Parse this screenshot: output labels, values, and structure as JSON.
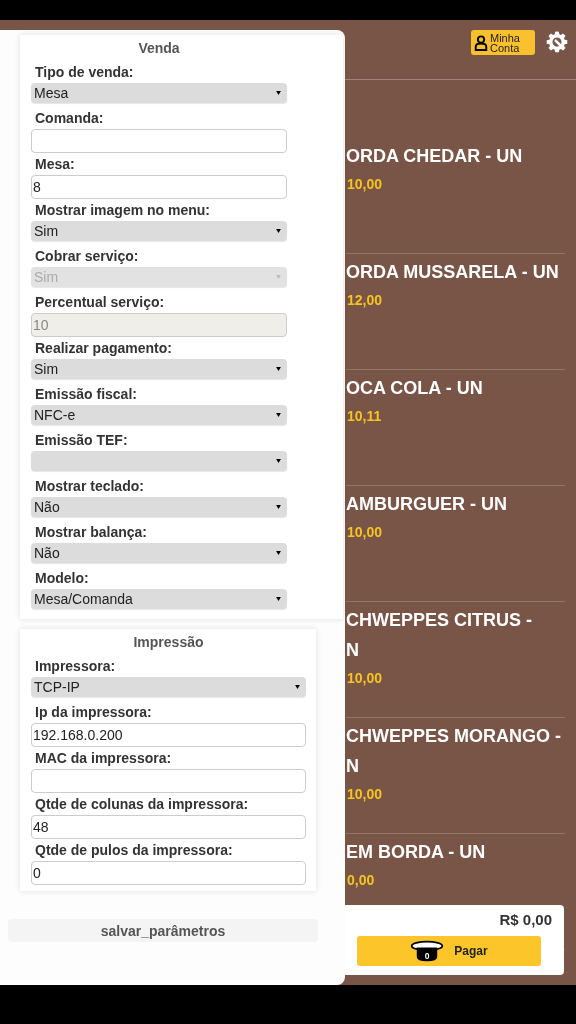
{
  "header": {
    "account_button": {
      "label": "Minha Conta"
    }
  },
  "products": [
    {
      "lines": [
        "ORDA CHEDAR - UN"
      ],
      "price": "10,00"
    },
    {
      "lines": [
        "ORDA MUSSARELA - UN"
      ],
      "price": "12,00"
    },
    {
      "lines": [
        "OCA COLA - UN"
      ],
      "price": "10,11"
    },
    {
      "lines": [
        "AMBURGUER - UN"
      ],
      "price": "10,00"
    },
    {
      "lines": [
        "CHWEPPES CITRUS -",
        "N"
      ],
      "price": "10,00"
    },
    {
      "lines": [
        "CHWEPPES MORANGO -",
        "N"
      ],
      "price": "10,00"
    },
    {
      "lines": [
        "EM BORDA - UN"
      ],
      "price": "0,00"
    }
  ],
  "cart": {
    "total": "R$ 0,00",
    "item_count": "0",
    "pay_button": "Pagar"
  },
  "settings": {
    "sections": [
      {
        "title": "Venda",
        "fields": [
          {
            "label": "Tipo de venda:",
            "kind": "select",
            "value": "Mesa",
            "disabled": false
          },
          {
            "label": "Comanda:",
            "kind": "text",
            "disabled": false
          },
          {
            "label": "Mesa:",
            "kind": "text",
            "value": "8",
            "disabled": false
          },
          {
            "label": "Mostrar imagem no menu:",
            "kind": "select",
            "value": "Sim",
            "disabled": false
          },
          {
            "label": "Cobrar serviço:",
            "kind": "select",
            "value": "Sim",
            "disabled": true
          },
          {
            "label": "Percentual serviço:",
            "kind": "text",
            "value": "10",
            "disabled": true
          },
          {
            "label": "Realizar pagamento:",
            "kind": "select",
            "value": "Sim",
            "disabled": false
          },
          {
            "label": "Emissão fiscal:",
            "kind": "select",
            "value": "NFC-e",
            "disabled": false
          },
          {
            "label": "Emissão TEF:",
            "kind": "select",
            "disabled": false
          },
          {
            "label": "Mostrar teclado:",
            "kind": "select",
            "value": "Não",
            "disabled": false
          },
          {
            "label": "Mostrar balança:",
            "kind": "select",
            "value": "Não",
            "disabled": false
          },
          {
            "label": "Modelo:",
            "kind": "select",
            "value": "Mesa/Comanda",
            "disabled": false
          }
        ]
      },
      {
        "title": "Impressão",
        "fields": [
          {
            "label": "Impressora:",
            "kind": "select",
            "value": "TCP-IP",
            "disabled": false
          },
          {
            "label": "Ip da impressora:",
            "kind": "text",
            "value": "192.168.0.200",
            "disabled": false
          },
          {
            "label": "MAC da impressora:",
            "kind": "text",
            "disabled": false
          },
          {
            "label": "Qtde de colunas da impressora:",
            "kind": "text",
            "value": "48",
            "disabled": false
          },
          {
            "label": "Qtde de pulos da impressora:",
            "kind": "text",
            "value": "0",
            "disabled": false
          }
        ]
      }
    ],
    "save_button": "salvar_parâmetros"
  }
}
